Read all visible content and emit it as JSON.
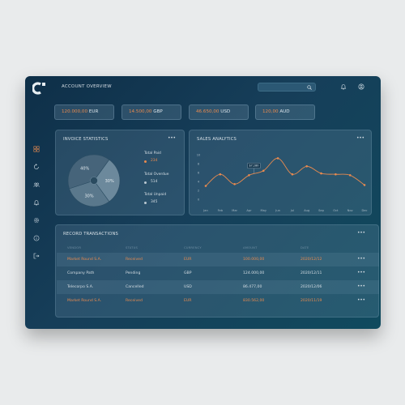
{
  "header": {
    "title": "ACCOUNT OVERVIEW",
    "search_placeholder": ""
  },
  "balances": [
    {
      "amount": "120.000,00",
      "code": "EUR"
    },
    {
      "amount": "14.500,00",
      "code": "GBP"
    },
    {
      "amount": "46.650,00",
      "code": "USD"
    },
    {
      "amount": "120,00",
      "code": "AUD"
    }
  ],
  "sidebar": {
    "icons": [
      "dashboard-icon",
      "refresh-icon",
      "users-icon",
      "bell-icon",
      "settings-icon",
      "info-icon",
      "logout-icon"
    ]
  },
  "invoice": {
    "title": "INVOICE STATISTICS",
    "more": "•••",
    "items": [
      {
        "label": "Total Paid",
        "value": "234",
        "color": "#e88a4f"
      },
      {
        "label": "Total Overdue",
        "value": "514",
        "color": "#d6dfe5"
      },
      {
        "label": "Total Unpaid",
        "value": "345",
        "color": "#d6dfe5"
      }
    ],
    "pie": [
      {
        "label": "30%",
        "value": 30,
        "color": "#6c899c"
      },
      {
        "label": "30%",
        "value": 30,
        "color": "#5a788c"
      },
      {
        "label": "40%",
        "value": 40,
        "color": "#46647a"
      }
    ]
  },
  "sales": {
    "title": "SALES ANALYTICS",
    "more": "•••",
    "tooltip": "$7,180",
    "chart_data": {
      "type": "line",
      "categories": [
        "Jan",
        "Feb",
        "Mar",
        "Apr",
        "May",
        "Jun",
        "Jul",
        "Aug",
        "Sep",
        "Oct",
        "Nov",
        "Dec"
      ],
      "values": [
        3.0,
        5.6,
        3.4,
        5.4,
        6.4,
        9.2,
        5.6,
        7.4,
        5.8,
        5.6,
        5.4,
        3.2
      ],
      "yticks": [
        "0",
        "2",
        "4",
        "6",
        "8",
        "10"
      ],
      "ylim": [
        0,
        10
      ],
      "line_color": "#e88a4f"
    }
  },
  "transactions": {
    "title": "RECORD TRANSACTIONS",
    "more": "•••",
    "headers": [
      "VENDOR",
      "STATUS",
      "CURRENCY",
      "AMOUNT",
      "DATE"
    ],
    "rows": [
      {
        "vendor": "Market Round S.A.",
        "status": "Received",
        "currency": "EUR",
        "amount": "100.000,00",
        "date": "2020/12/12",
        "highlight": true,
        "more": "•••"
      },
      {
        "vendor": "Company Path",
        "status": "Pending",
        "currency": "GBP",
        "amount": "124.000,00",
        "date": "2020/12/11",
        "highlight": false,
        "more": "•••"
      },
      {
        "vendor": "Telecorpo S.A.",
        "status": "Cancelled",
        "currency": "USD",
        "amount": "86.477,00",
        "date": "2020/12/06",
        "highlight": false,
        "more": "•••"
      },
      {
        "vendor": "Market Round S.A.",
        "status": "Received",
        "currency": "EUR",
        "amount": "830.562,00",
        "date": "2020/11/19",
        "highlight": true,
        "more": "•••"
      }
    ],
    "highlight_color": "#e88a4f",
    "text_color": "#d4dde3"
  }
}
